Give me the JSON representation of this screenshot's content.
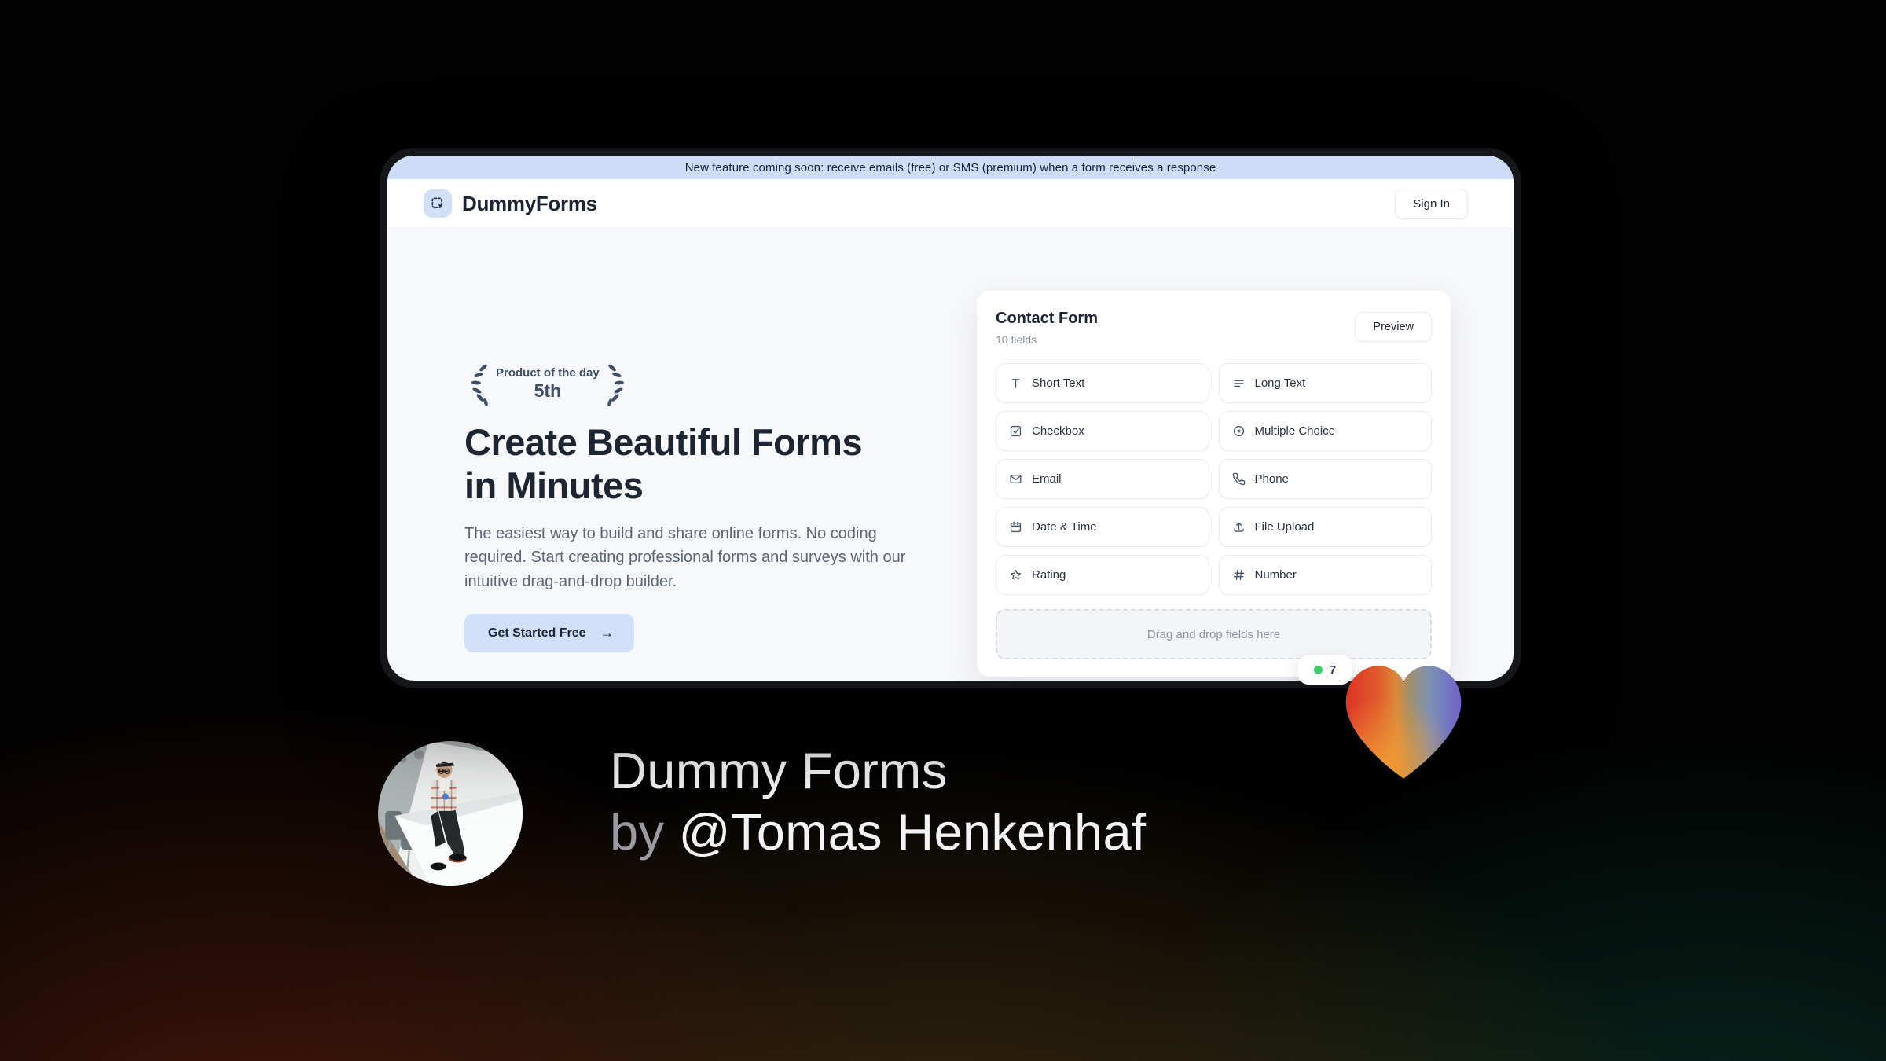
{
  "window": {
    "banner": {
      "text": "New feature coming soon: receive emails (free) or SMS (premium) when a form receives a response"
    },
    "header": {
      "brand": "DummyForms",
      "sign_in_label": "Sign In"
    },
    "hero": {
      "award_badge": {
        "line1": "Product of the day",
        "line2": "5th"
      },
      "headline": "Create Beautiful Forms in Minutes",
      "subheadline": "The easiest way to build and share online forms. No coding required. Start creating professional forms and surveys with our intuitive drag-and-drop builder.",
      "cta_label": "Get Started Free",
      "cta_arrow": "→"
    },
    "form_card": {
      "title": "Contact Form",
      "subtitle": "10 fields",
      "preview_label": "Preview",
      "fields": [
        {
          "label": "Short Text",
          "icon": "short-text-icon"
        },
        {
          "label": "Long Text",
          "icon": "long-text-icon"
        },
        {
          "label": "Checkbox",
          "icon": "checkbox-icon"
        },
        {
          "label": "Multiple Choice",
          "icon": "multiple-choice-icon"
        },
        {
          "label": "Email",
          "icon": "email-icon"
        },
        {
          "label": "Phone",
          "icon": "phone-icon"
        },
        {
          "label": "Date & Time",
          "icon": "calendar-icon"
        },
        {
          "label": "File Upload",
          "icon": "upload-icon"
        },
        {
          "label": "Rating",
          "icon": "star-icon"
        },
        {
          "label": "Number",
          "icon": "hash-icon"
        }
      ],
      "dropzone_text": "Drag and drop fields here",
      "status_badge": {
        "text": "7",
        "dot_color": "#3ecf6f"
      }
    }
  },
  "attribution": {
    "title": "Dummy Forms",
    "byline_prefix": "by",
    "byline_handle": "@Tomas Henkenhaf"
  },
  "colors": {
    "accent_blue": "#cfe0f8",
    "banner_blue": "#cdddf8",
    "navy_text": "#1d2533",
    "slate_text": "#5b6676",
    "status_green": "#3ecf6f",
    "heart_gradient": [
      "#dd3425",
      "#e05a2b",
      "#e98a3a",
      "#8f8f7d",
      "#7d92b4",
      "#6f63c8"
    ]
  }
}
